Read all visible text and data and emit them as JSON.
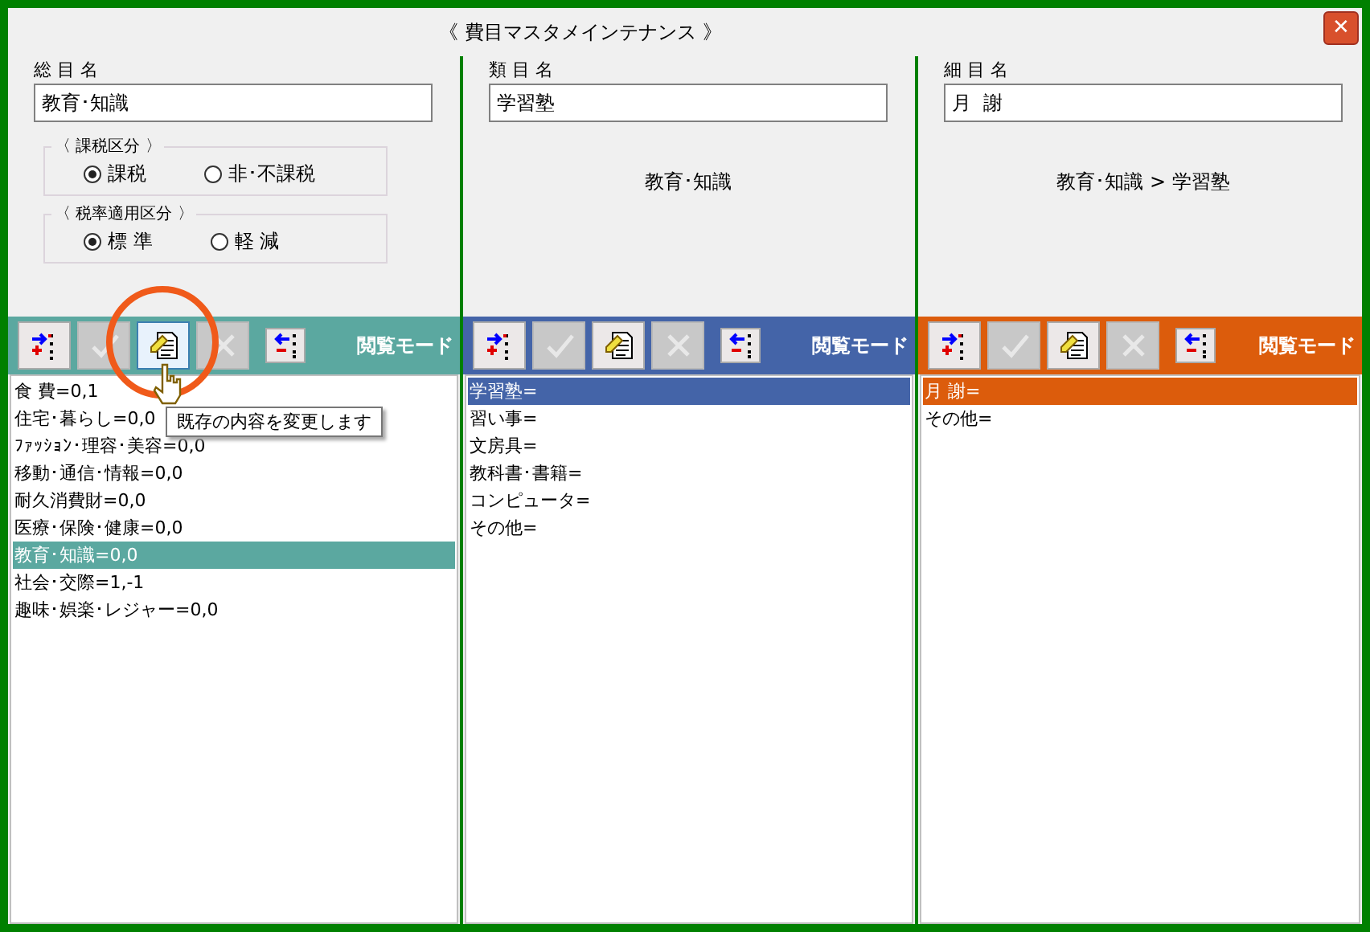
{
  "window": {
    "title": "《 費目マスタメインテナンス 》",
    "close": "✕"
  },
  "columns": [
    {
      "color": "#5ba8a0",
      "label": "総 目 名",
      "value": "教育･知識",
      "groups": [
        {
          "title": "〈 課税区分 〉",
          "options": [
            {
              "label": "課税",
              "selected": true
            },
            {
              "label": "非･不課税",
              "selected": false
            }
          ]
        },
        {
          "title": "〈 税率適用区分 〉",
          "options": [
            {
              "label": "標 準",
              "selected": true
            },
            {
              "label": "軽 減",
              "selected": false
            }
          ]
        }
      ],
      "buttons": [
        {
          "kind": "add",
          "disabled": false,
          "hovered": false
        },
        {
          "kind": "confirm",
          "disabled": true,
          "hovered": false
        },
        {
          "kind": "edit",
          "disabled": false,
          "hovered": true
        },
        {
          "kind": "cancel",
          "disabled": true,
          "hovered": false
        },
        {
          "kind": "remove",
          "disabled": false,
          "hovered": false
        }
      ],
      "mode": "閲覧モード",
      "items": [
        {
          "text": "食  費=0,1",
          "selected": false
        },
        {
          "text": "住宅･暮らし=0,0",
          "selected": false
        },
        {
          "text": "ﾌｧｯｼｮﾝ･理容･美容=0,0",
          "selected": false
        },
        {
          "text": "移動･通信･情報=0,0",
          "selected": false
        },
        {
          "text": "耐久消費財=0,0",
          "selected": false
        },
        {
          "text": "医療･保険･健康=0,0",
          "selected": false
        },
        {
          "text": "教育･知識=0,0",
          "selected": true
        },
        {
          "text": "社会･交際=1,-1",
          "selected": false
        },
        {
          "text": "趣味･娯楽･レジャー=0,0",
          "selected": false
        }
      ]
    },
    {
      "color": "#4464a8",
      "label": "類 目 名",
      "value": "学習塾",
      "path": "教育･知識",
      "buttons": [
        {
          "kind": "add",
          "disabled": false,
          "hovered": false
        },
        {
          "kind": "confirm",
          "disabled": true,
          "hovered": false
        },
        {
          "kind": "edit",
          "disabled": false,
          "hovered": false
        },
        {
          "kind": "cancel",
          "disabled": true,
          "hovered": false
        },
        {
          "kind": "remove",
          "disabled": false,
          "hovered": false
        }
      ],
      "mode": "閲覧モード",
      "items": [
        {
          "text": "学習塾=",
          "selected": true
        },
        {
          "text": "習い事=",
          "selected": false
        },
        {
          "text": "文房具=",
          "selected": false
        },
        {
          "text": "教科書･書籍=",
          "selected": false
        },
        {
          "text": "コンピュータ=",
          "selected": false
        },
        {
          "text": "その他=",
          "selected": false
        }
      ]
    },
    {
      "color": "#dc5c0c",
      "label": "細 目 名",
      "value": "月  謝",
      "path": "教育･知識 > 学習塾",
      "buttons": [
        {
          "kind": "add",
          "disabled": false,
          "hovered": false
        },
        {
          "kind": "confirm",
          "disabled": true,
          "hovered": false
        },
        {
          "kind": "edit",
          "disabled": false,
          "hovered": false
        },
        {
          "kind": "cancel",
          "disabled": true,
          "hovered": false
        },
        {
          "kind": "remove",
          "disabled": false,
          "hovered": false
        }
      ],
      "mode": "閲覧モード",
      "items": [
        {
          "text": "月  謝=",
          "selected": true
        },
        {
          "text": "その他=",
          "selected": false
        }
      ]
    }
  ],
  "tooltip": "既存の内容を変更します"
}
